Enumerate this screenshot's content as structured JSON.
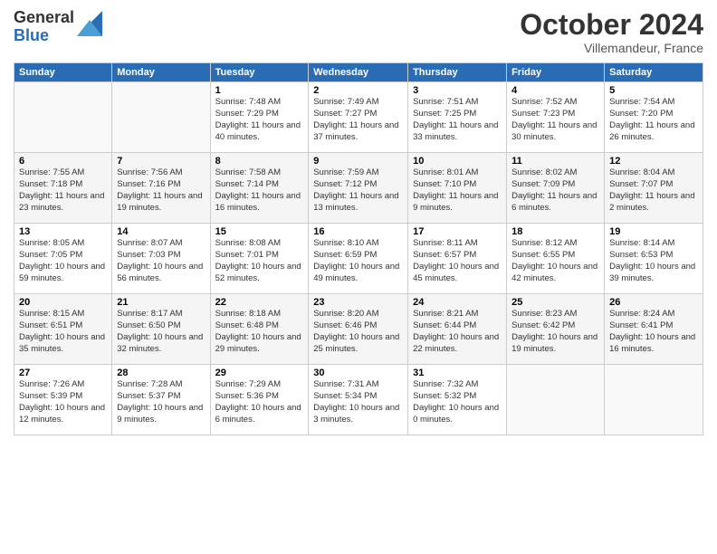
{
  "logo": {
    "general": "General",
    "blue": "Blue"
  },
  "header": {
    "month": "October 2024",
    "location": "Villemandeur, France"
  },
  "weekdays": [
    "Sunday",
    "Monday",
    "Tuesday",
    "Wednesday",
    "Thursday",
    "Friday",
    "Saturday"
  ],
  "weeks": [
    [
      {
        "day": "",
        "sunrise": "",
        "sunset": "",
        "daylight": ""
      },
      {
        "day": "",
        "sunrise": "",
        "sunset": "",
        "daylight": ""
      },
      {
        "day": "1",
        "sunrise": "Sunrise: 7:48 AM",
        "sunset": "Sunset: 7:29 PM",
        "daylight": "Daylight: 11 hours and 40 minutes."
      },
      {
        "day": "2",
        "sunrise": "Sunrise: 7:49 AM",
        "sunset": "Sunset: 7:27 PM",
        "daylight": "Daylight: 11 hours and 37 minutes."
      },
      {
        "day": "3",
        "sunrise": "Sunrise: 7:51 AM",
        "sunset": "Sunset: 7:25 PM",
        "daylight": "Daylight: 11 hours and 33 minutes."
      },
      {
        "day": "4",
        "sunrise": "Sunrise: 7:52 AM",
        "sunset": "Sunset: 7:23 PM",
        "daylight": "Daylight: 11 hours and 30 minutes."
      },
      {
        "day": "5",
        "sunrise": "Sunrise: 7:54 AM",
        "sunset": "Sunset: 7:20 PM",
        "daylight": "Daylight: 11 hours and 26 minutes."
      }
    ],
    [
      {
        "day": "6",
        "sunrise": "Sunrise: 7:55 AM",
        "sunset": "Sunset: 7:18 PM",
        "daylight": "Daylight: 11 hours and 23 minutes."
      },
      {
        "day": "7",
        "sunrise": "Sunrise: 7:56 AM",
        "sunset": "Sunset: 7:16 PM",
        "daylight": "Daylight: 11 hours and 19 minutes."
      },
      {
        "day": "8",
        "sunrise": "Sunrise: 7:58 AM",
        "sunset": "Sunset: 7:14 PM",
        "daylight": "Daylight: 11 hours and 16 minutes."
      },
      {
        "day": "9",
        "sunrise": "Sunrise: 7:59 AM",
        "sunset": "Sunset: 7:12 PM",
        "daylight": "Daylight: 11 hours and 13 minutes."
      },
      {
        "day": "10",
        "sunrise": "Sunrise: 8:01 AM",
        "sunset": "Sunset: 7:10 PM",
        "daylight": "Daylight: 11 hours and 9 minutes."
      },
      {
        "day": "11",
        "sunrise": "Sunrise: 8:02 AM",
        "sunset": "Sunset: 7:09 PM",
        "daylight": "Daylight: 11 hours and 6 minutes."
      },
      {
        "day": "12",
        "sunrise": "Sunrise: 8:04 AM",
        "sunset": "Sunset: 7:07 PM",
        "daylight": "Daylight: 11 hours and 2 minutes."
      }
    ],
    [
      {
        "day": "13",
        "sunrise": "Sunrise: 8:05 AM",
        "sunset": "Sunset: 7:05 PM",
        "daylight": "Daylight: 10 hours and 59 minutes."
      },
      {
        "day": "14",
        "sunrise": "Sunrise: 8:07 AM",
        "sunset": "Sunset: 7:03 PM",
        "daylight": "Daylight: 10 hours and 56 minutes."
      },
      {
        "day": "15",
        "sunrise": "Sunrise: 8:08 AM",
        "sunset": "Sunset: 7:01 PM",
        "daylight": "Daylight: 10 hours and 52 minutes."
      },
      {
        "day": "16",
        "sunrise": "Sunrise: 8:10 AM",
        "sunset": "Sunset: 6:59 PM",
        "daylight": "Daylight: 10 hours and 49 minutes."
      },
      {
        "day": "17",
        "sunrise": "Sunrise: 8:11 AM",
        "sunset": "Sunset: 6:57 PM",
        "daylight": "Daylight: 10 hours and 45 minutes."
      },
      {
        "day": "18",
        "sunrise": "Sunrise: 8:12 AM",
        "sunset": "Sunset: 6:55 PM",
        "daylight": "Daylight: 10 hours and 42 minutes."
      },
      {
        "day": "19",
        "sunrise": "Sunrise: 8:14 AM",
        "sunset": "Sunset: 6:53 PM",
        "daylight": "Daylight: 10 hours and 39 minutes."
      }
    ],
    [
      {
        "day": "20",
        "sunrise": "Sunrise: 8:15 AM",
        "sunset": "Sunset: 6:51 PM",
        "daylight": "Daylight: 10 hours and 35 minutes."
      },
      {
        "day": "21",
        "sunrise": "Sunrise: 8:17 AM",
        "sunset": "Sunset: 6:50 PM",
        "daylight": "Daylight: 10 hours and 32 minutes."
      },
      {
        "day": "22",
        "sunrise": "Sunrise: 8:18 AM",
        "sunset": "Sunset: 6:48 PM",
        "daylight": "Daylight: 10 hours and 29 minutes."
      },
      {
        "day": "23",
        "sunrise": "Sunrise: 8:20 AM",
        "sunset": "Sunset: 6:46 PM",
        "daylight": "Daylight: 10 hours and 25 minutes."
      },
      {
        "day": "24",
        "sunrise": "Sunrise: 8:21 AM",
        "sunset": "Sunset: 6:44 PM",
        "daylight": "Daylight: 10 hours and 22 minutes."
      },
      {
        "day": "25",
        "sunrise": "Sunrise: 8:23 AM",
        "sunset": "Sunset: 6:42 PM",
        "daylight": "Daylight: 10 hours and 19 minutes."
      },
      {
        "day": "26",
        "sunrise": "Sunrise: 8:24 AM",
        "sunset": "Sunset: 6:41 PM",
        "daylight": "Daylight: 10 hours and 16 minutes."
      }
    ],
    [
      {
        "day": "27",
        "sunrise": "Sunrise: 7:26 AM",
        "sunset": "Sunset: 5:39 PM",
        "daylight": "Daylight: 10 hours and 12 minutes."
      },
      {
        "day": "28",
        "sunrise": "Sunrise: 7:28 AM",
        "sunset": "Sunset: 5:37 PM",
        "daylight": "Daylight: 10 hours and 9 minutes."
      },
      {
        "day": "29",
        "sunrise": "Sunrise: 7:29 AM",
        "sunset": "Sunset: 5:36 PM",
        "daylight": "Daylight: 10 hours and 6 minutes."
      },
      {
        "day": "30",
        "sunrise": "Sunrise: 7:31 AM",
        "sunset": "Sunset: 5:34 PM",
        "daylight": "Daylight: 10 hours and 3 minutes."
      },
      {
        "day": "31",
        "sunrise": "Sunrise: 7:32 AM",
        "sunset": "Sunset: 5:32 PM",
        "daylight": "Daylight: 10 hours and 0 minutes."
      },
      {
        "day": "",
        "sunrise": "",
        "sunset": "",
        "daylight": ""
      },
      {
        "day": "",
        "sunrise": "",
        "sunset": "",
        "daylight": ""
      }
    ]
  ]
}
